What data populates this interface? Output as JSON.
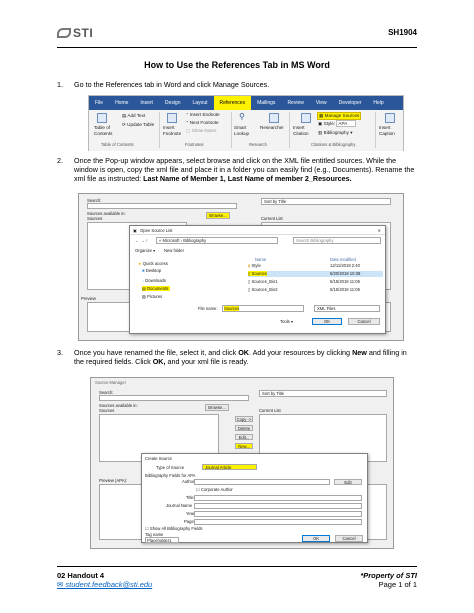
{
  "header": {
    "logo": "STI",
    "doc_id": "SH1904"
  },
  "title": "How to Use the References Tab in MS Word",
  "steps": [
    {
      "num": "1.",
      "text": "Go to the References tab in Word and click Manage Sources."
    },
    {
      "num": "2.",
      "text": "Once the Pop-up window appears, select browse and click on the XML file entitled sources. While the window is open, copy the xml file and place it in a folder you can easily find (e.g., Documents). Rename the xml file as instructed: Last Name of Member 1, Last Name of member 2_Resources."
    },
    {
      "num": "3.",
      "text": "Once you have renamed the file, select it, and click OK. Add your resources by clicking New and filling in the required fields. Click OK, and your xml file is ready."
    }
  ],
  "ribbon": {
    "tabs": [
      "File",
      "Home",
      "Insert",
      "Design",
      "Layout",
      "References",
      "Mailings",
      "Review",
      "View",
      "Developer",
      "Help"
    ],
    "active_tab": "References",
    "add_text": "Add Text",
    "update_table": "Update Table",
    "table_of_contents": "Table of Contents",
    "insert_endnote": "Insert Endnote",
    "next_footnote": "Next Footnote",
    "show_notes": "Show Notes",
    "insert_footnote": "Insert Footnote",
    "smart_lookup": "Smart Lookup",
    "researcher": "Researcher",
    "insert_citation": "Insert Citation",
    "manage_sources": "Manage Sources",
    "style_label": "Style:",
    "style_value": "APA",
    "bibliography": "Bibliography",
    "insert_caption": "Insert Caption",
    "groups": [
      "Table of Contents",
      "Footnotes",
      "Research",
      "Citations & Bibliography"
    ]
  },
  "source_manager": {
    "search_label": "Search:",
    "sort_value": "Sort by Title",
    "sources_available": "Sources available in:",
    "sources_value": "Sources",
    "browse": "Browse...",
    "current_list": "Current List",
    "preview": "Preview",
    "open_dialog": {
      "title": "Open Source List",
      "breadcrumb": "« Microsoft › Bibliography",
      "search_placeholder": "Search Bibliography",
      "organize": "Organize",
      "new_folder": "New folder",
      "nav": [
        "Quick access",
        "Desktop",
        "Downloads",
        "Documents",
        "Pictures"
      ],
      "col_name": "Name",
      "col_date": "Date modified",
      "files": [
        {
          "name": "Style",
          "date": "12/11/2018 2:40"
        },
        {
          "name": "Sources",
          "date": "5/20/2019 10:38"
        },
        {
          "name": "Sources_Bio1",
          "date": "5/15/2019 11:06"
        },
        {
          "name": "Sources_Bio2",
          "date": "5/15/2019 11:06"
        }
      ],
      "file_name_label": "File name:",
      "file_name_value": "Sources",
      "file_type": "XML Files",
      "tools": "Tools",
      "ok": "OK",
      "cancel": "Cancel"
    }
  },
  "source_manager2": {
    "window_title": "Source Manager",
    "search_label": "Search:",
    "sort_value": "Sort by Title",
    "sources_available": "Sources available in:",
    "sources_value": "Sources",
    "browse": "Browse...",
    "current_list": "Current List",
    "side_buttons": [
      "Copy ->",
      "Delete",
      "Edit...",
      "New..."
    ],
    "preview": "Preview (APA):",
    "create_source": {
      "title": "Create Source",
      "type_label": "Type of Source",
      "type_value": "Journal Article",
      "fields_label": "Bibliography Fields for APA",
      "author": "Author",
      "edit": "Edit",
      "corporate_author": "Corporate Author",
      "title_field": "Title",
      "journal_name": "Journal Name",
      "year": "Year",
      "pages": "Pages",
      "show_all": "Show All Bibliography Fields",
      "tag_name": "Tag name",
      "tag_value": "Placeholder1",
      "ok": "OK",
      "cancel": "Cancel"
    }
  },
  "footer": {
    "handout": "02 Handout 4",
    "email": "student.feedback@sti.edu",
    "property": "*Property of STI",
    "page": "Page 1 of 1"
  },
  "colors": {
    "word_blue": "#2b579a",
    "highlight": "#fff200",
    "link": "#0563c1"
  }
}
